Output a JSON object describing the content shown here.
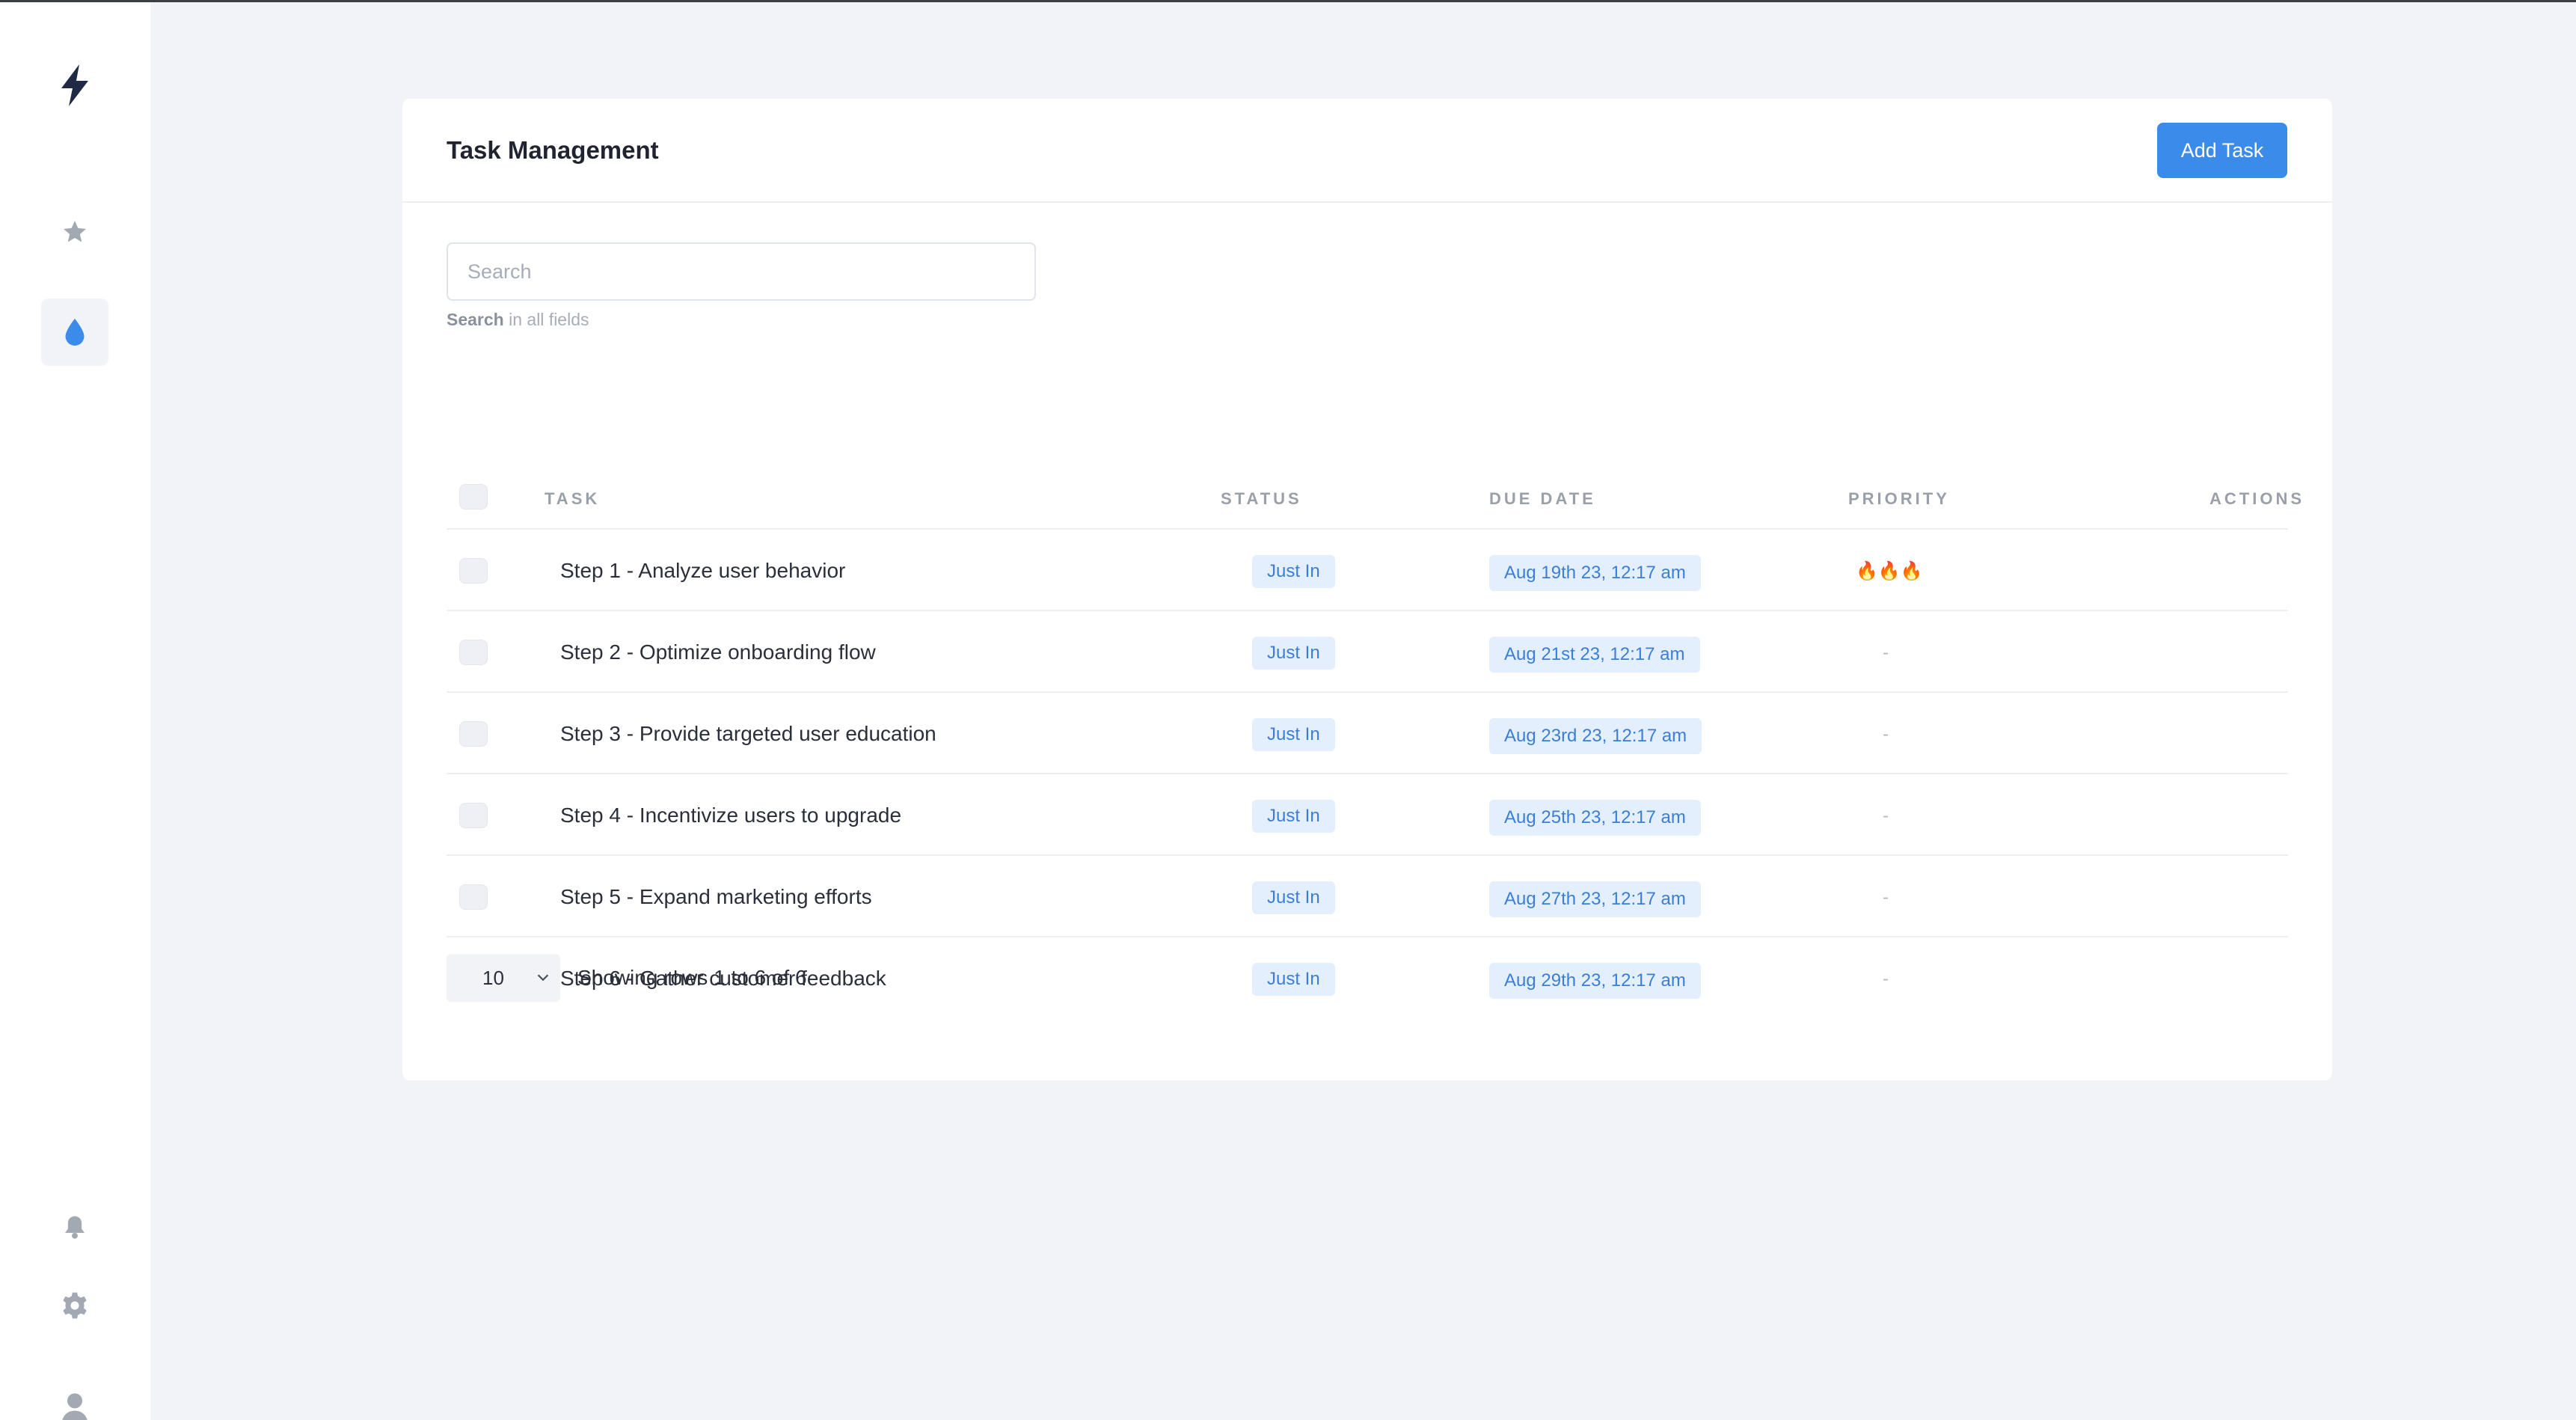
{
  "sidebar": {
    "icons": [
      "bolt-icon",
      "star-icon",
      "drop-icon",
      "bell-icon",
      "gear-icon",
      "user-icon"
    ],
    "active_item": "drop-icon"
  },
  "header": {
    "title": "Task Management",
    "add_button_label": "Add Task"
  },
  "search": {
    "placeholder": "Search",
    "help_bold": "Search",
    "help_rest": " in all fields"
  },
  "table": {
    "columns": [
      "TASK",
      "STATUS",
      "DUE DATE",
      "PRIORITY",
      "ACTIONS"
    ],
    "rows": [
      {
        "task": "Step 1 - Analyze user behavior",
        "status": "Just In",
        "due": "Aug 19th 23, 12:17 am",
        "priority": "🔥🔥🔥"
      },
      {
        "task": "Step 2 - Optimize onboarding flow",
        "status": "Just In",
        "due": "Aug 21st 23, 12:17 am",
        "priority": "-"
      },
      {
        "task": "Step 3 - Provide targeted user education",
        "status": "Just In",
        "due": "Aug 23rd 23, 12:17 am",
        "priority": "-"
      },
      {
        "task": "Step 4 - Incentivize users to upgrade",
        "status": "Just In",
        "due": "Aug 25th 23, 12:17 am",
        "priority": "-"
      },
      {
        "task": "Step 5 - Expand marketing efforts",
        "status": "Just In",
        "due": "Aug 27th 23, 12:17 am",
        "priority": "-"
      },
      {
        "task": "Step 6 - Gather customer feedback",
        "status": "Just In",
        "due": "Aug 29th 23, 12:17 am",
        "priority": "-"
      }
    ]
  },
  "footer": {
    "page_size": "10",
    "showing_text": "Showing rows 1 to 6 of 6"
  },
  "colors": {
    "accent": "#3b8bea",
    "badge_bg": "#e4effd",
    "badge_text": "#3b7ed6",
    "delete": "#e53935",
    "background": "#f1f3f9"
  }
}
